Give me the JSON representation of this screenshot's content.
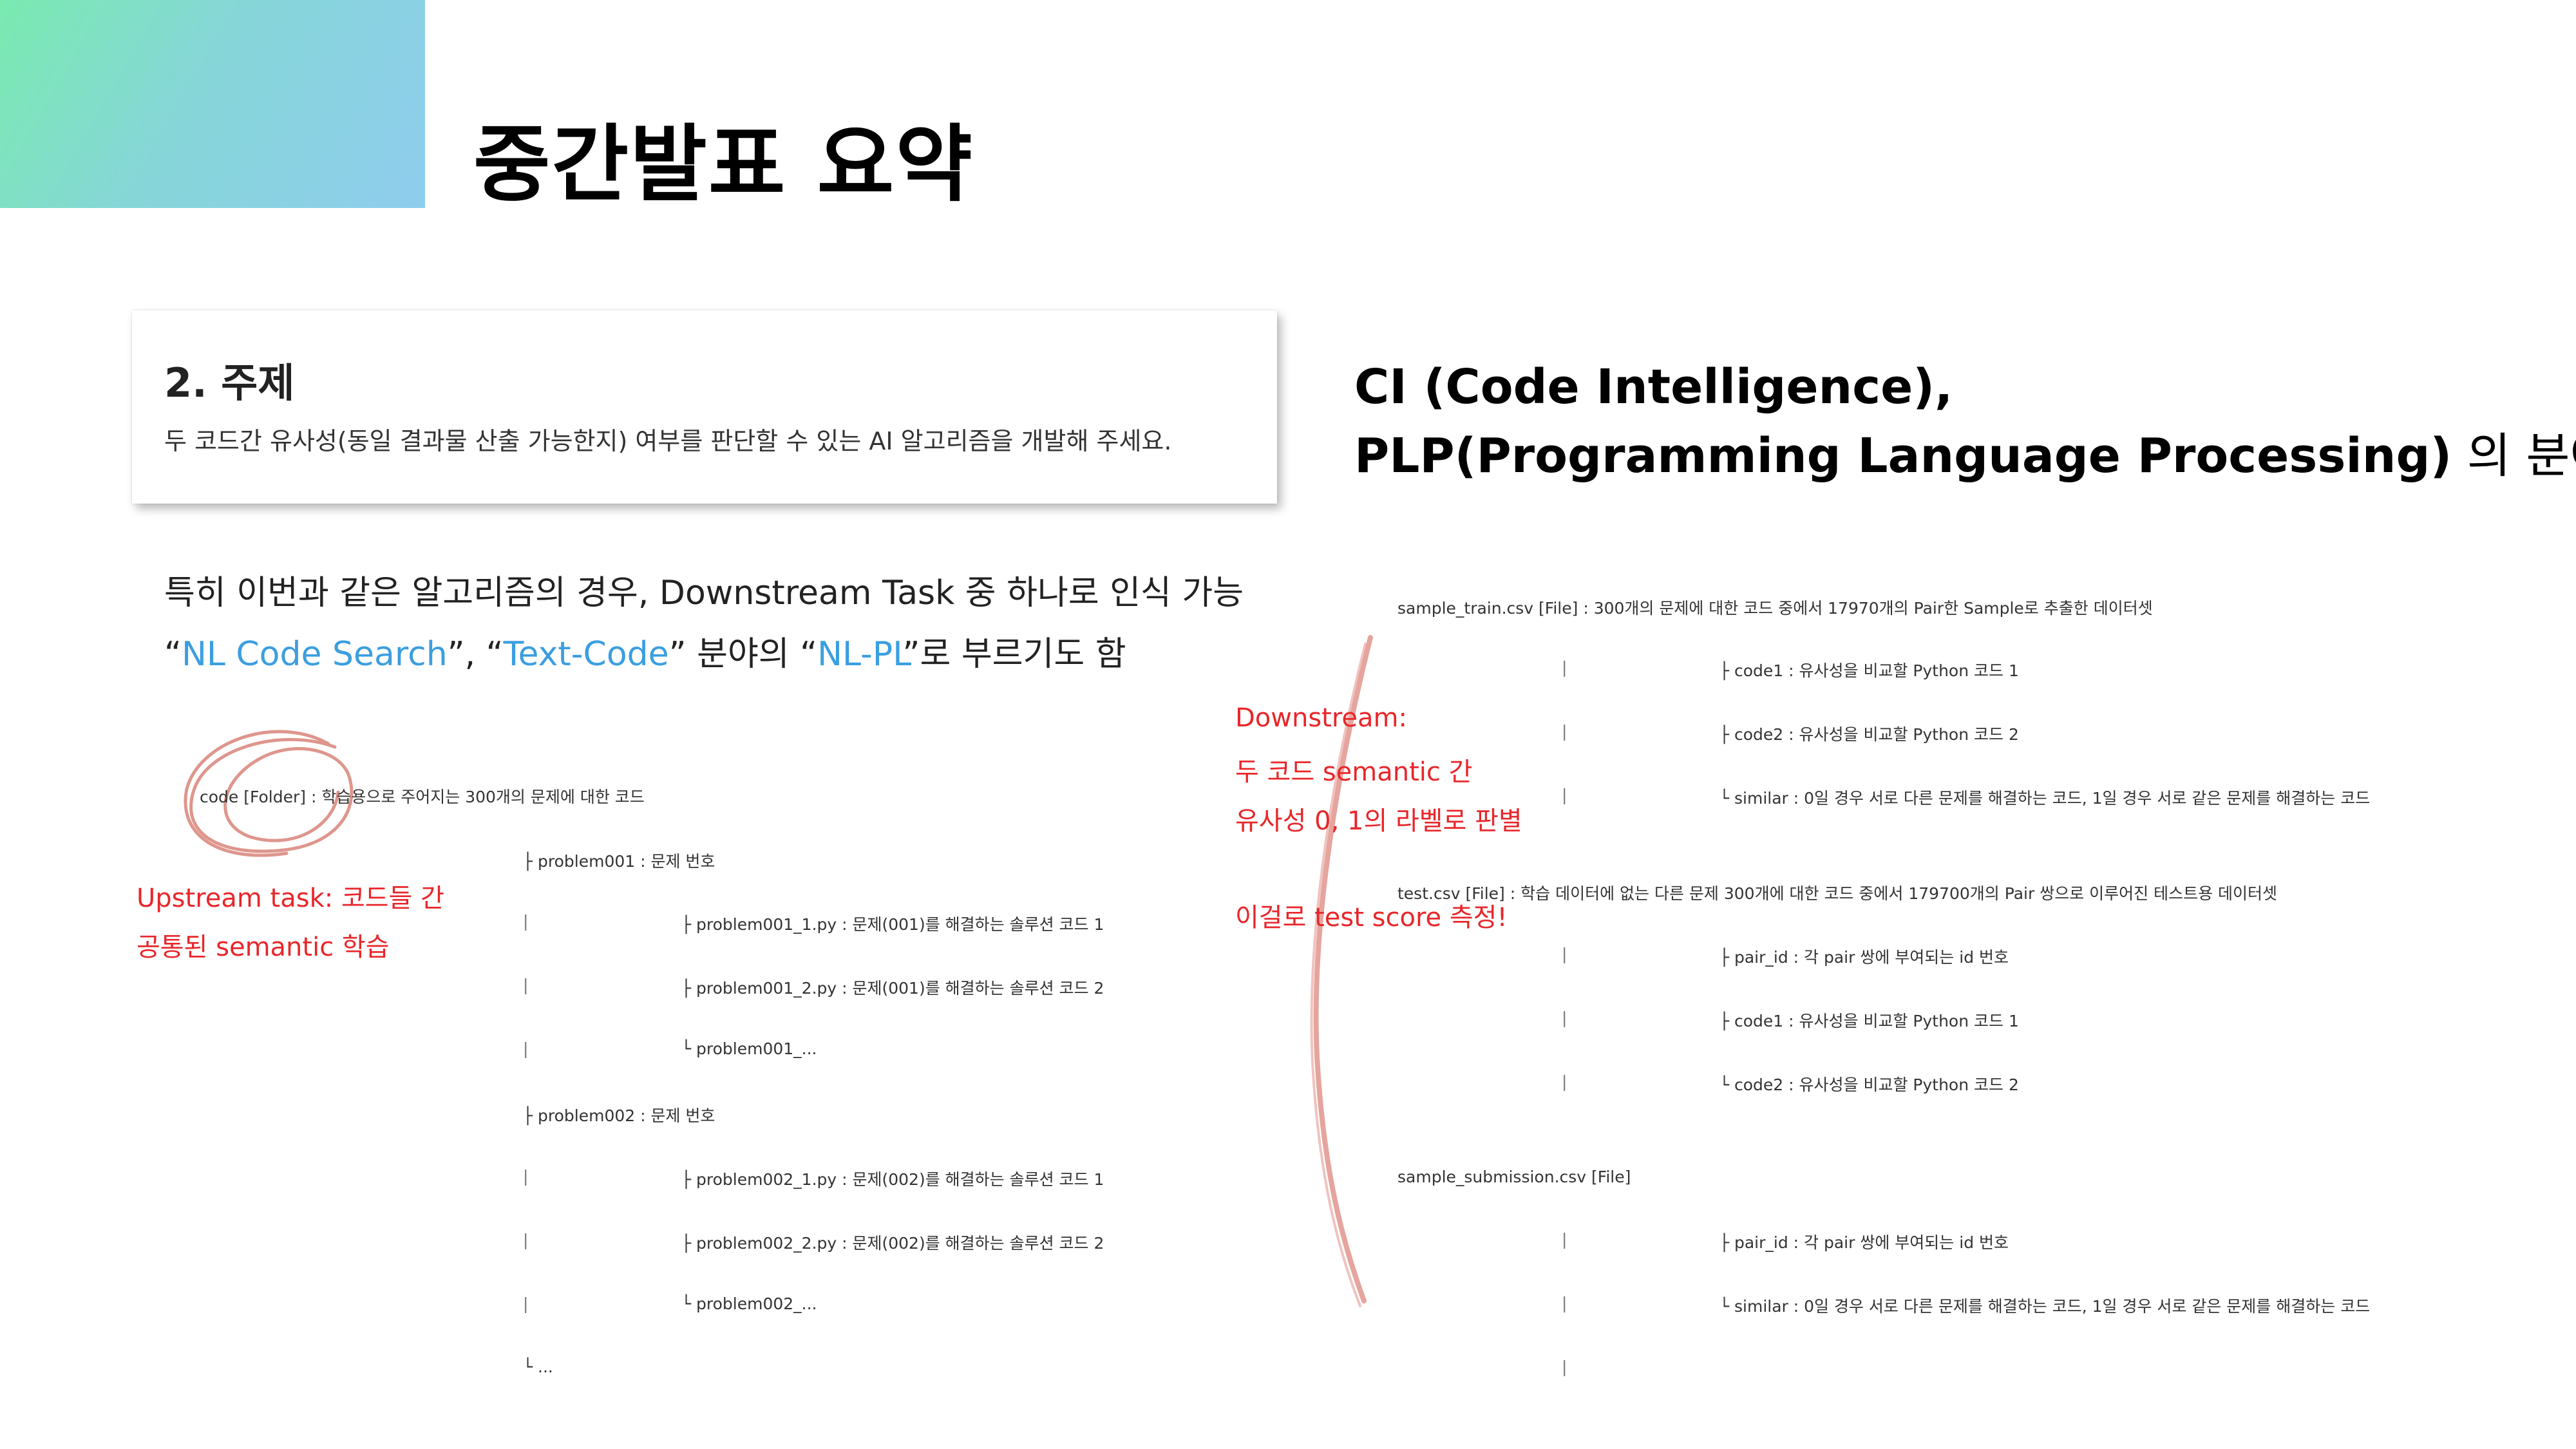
{
  "title": "중간발표 요약",
  "topic_card": {
    "heading": "2. 주제",
    "description": "두 코드간 유사성(동일 결과물 산출 가능한지) 여부를 판단할 수 있는 AI 알고리즘을 개발해 주세요."
  },
  "ci_block": {
    "line1": "CI (Code Intelligence),",
    "line2_bold": "PLP(Programming Language Processing)",
    "line2_rest": " 의 분야!"
  },
  "body": {
    "line1": "특히 이번과 같은 알고리즘의 경우, Downstream Task 중 하나로 인식 가능",
    "line2_q1_open": "“",
    "line2_nl_code_search": "NL Code Search",
    "line2_sep1": "”, “",
    "line2_text_code": "Text-Code",
    "line2_sep2": "” 분야의 “",
    "line2_nl_pl": "NL-PL",
    "line2_end": "”로 부르기도 함"
  },
  "annotations": {
    "upstream_line1": "Upstream task: 코드들 간",
    "upstream_line2": "공통된 semantic 학습",
    "downstream_line1": "Downstream:",
    "downstream_line2": "두 코드 semantic 간",
    "downstream_line3": "유사성 0, 1의 라벨로 판별",
    "downstream_line4": "이걸로 test score 측정!"
  },
  "left_tree": {
    "root": "code [Folder] : 학습용으로 주어지는 300개의 문제에 대한 코드",
    "problem001": "├ problem001 : 문제 번호",
    "p001_1": "├ problem001_1.py : 문제(001)를 해결하는 솔루션 코드 1",
    "p001_2": "├ problem001_2.py : 문제(001)를 해결하는 솔루션 코드 2",
    "p001_more": "└ problem001_...",
    "problem002": "├ problem002 : 문제 번호",
    "p002_1": "├ problem002_1.py : 문제(002)를 해결하는 솔루션 코드 1",
    "p002_2": "├ problem002_2.py : 문제(002)를 해결하는 솔루션 코드 2",
    "p002_more": "└ problem002_...",
    "end": "└ ..."
  },
  "right_tree": {
    "sample_train": "sample_train.csv [File] : 300개의 문제에 대한 코드 중에서 17970개의 Pair한 Sample로 추출한 데이터셋",
    "st_code1": "├ code1 : 유사성을 비교할 Python 코드 1",
    "st_code2": "├ code2 : 유사성을 비교할 Python 코드 2",
    "st_similar": "└ similar : 0일 경우 서로 다른 문제를 해결하는 코드, 1일 경우 서로 같은 문제를 해결하는 코드",
    "test": "test.csv [File] : 학습 데이터에 없는 다른 문제 300개에 대한 코드 중에서 179700개의 Pair 쌍으로 이루어진 테스트용 데이터셋",
    "t_pair_id": "├ pair_id : 각 pair 쌍에 부여되는 id 번호",
    "t_code1": "├ code1 : 유사성을 비교할 Python 코드 1",
    "t_code2": "└ code2 : 유사성을 비교할 Python 코드 2",
    "sample_submission": "sample_submission.csv [File]",
    "ss_pair_id": "├ pair_id : 각 pair 쌍에 부여되는 id 번호",
    "ss_similar": "└ similar : 0일 경우 서로 다른 문제를 해결하는 코드, 1일 경우 서로 같은 문제를 해결하는 코드"
  },
  "colors": {
    "accent_blue": "#3b9ee0",
    "annotation_red": "#e8262a",
    "corner_gradient_start": "#7aeab0",
    "corner_gradient_end": "#8fcdee"
  }
}
